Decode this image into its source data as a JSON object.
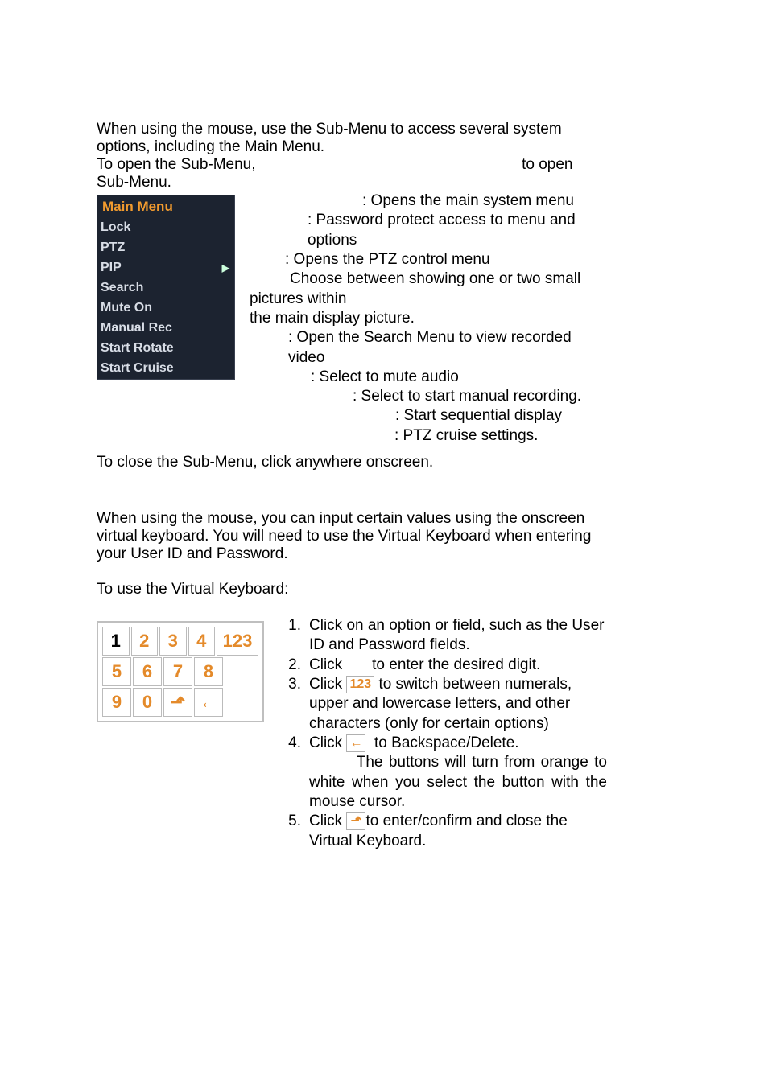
{
  "intro": {
    "p1": "When using the mouse, use the Sub-Menu to access several system options, including the Main Menu.",
    "p2a": "To open the Sub-Menu,",
    "p2b": "to open Sub-Menu."
  },
  "submenu": {
    "header": "Main  Menu",
    "items": [
      "Lock",
      "PTZ",
      "PIP",
      "Search",
      "Mute  On",
      "Manual  Rec",
      "Start  Rotate",
      "Start  Cruise"
    ],
    "arrow": "▶"
  },
  "desc": {
    "d1": ": Opens the main system menu",
    "d2": ": Password protect access to menu and options",
    "d3": ": Opens the PTZ control menu",
    "d4a": "Choose between showing one or two small pictures within",
    "d4b": "the main display picture.",
    "d5": ": Open the Search Menu to view recorded video",
    "d6": ": Select to mute audio",
    "d7": ": Select to start manual recording.",
    "d8": ": Start sequential display",
    "d9": ": PTZ cruise settings."
  },
  "close_text": "To close the Sub-Menu, click anywhere onscreen.",
  "vk": {
    "p1": "When using the mouse, you can input certain values using the onscreen virtual keyboard. You will need to use the Virtual Keyboard when entering your User ID and Password.",
    "p2": "To use the Virtual Keyboard:"
  },
  "keyboard": {
    "r1": [
      "1",
      "2",
      "3",
      "4",
      "123"
    ],
    "r2": [
      "5",
      "6",
      "7",
      "8"
    ],
    "r3": [
      "9",
      "0",
      "⬏",
      "←"
    ]
  },
  "steps": {
    "s1": "Click on an option or field, such as the User ID and Password fields.",
    "s2a": "Click",
    "s2b": "to enter the desired digit.",
    "s3a": "Click",
    "s3b": "to switch between numerals, upper and lowercase letters, and other characters (only for certain options)",
    "s3icon": "123",
    "s4a": "Click",
    "s4b": "to Backspace/Delete.",
    "s4icon": "←",
    "note": "The buttons will turn from orange to white when you select the button with the mouse cursor.",
    "s5a": "Click",
    "s5b": "to enter/confirm and close the Virtual Keyboard.",
    "s5icon": "⬏"
  }
}
